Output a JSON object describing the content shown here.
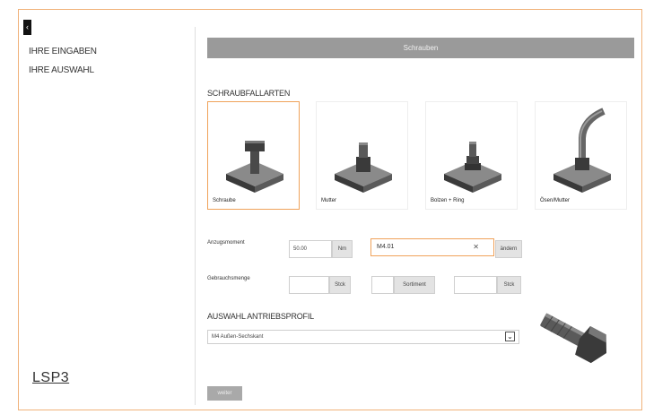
{
  "sidebar": {
    "items": [
      {
        "label": "IHRE EINGABEN"
      },
      {
        "label": "IHRE AUSWAHL"
      }
    ]
  },
  "logo": {
    "text": "LSP3"
  },
  "topbar": {
    "label": "Schrauben"
  },
  "schraubfall": {
    "heading": "SCHRAUBFALLARTEN",
    "cards": [
      {
        "label": "Schraube",
        "selected": true
      },
      {
        "label": "Mutter",
        "selected": false
      },
      {
        "label": "Bolzen + Ring",
        "selected": false
      },
      {
        "label": "Ösen/Mutter",
        "selected": false
      }
    ]
  },
  "row1": {
    "label": "Anzugsmoment",
    "value": "50.00",
    "unit": "Nm",
    "select_value": "M4.01",
    "select_clear": "✕",
    "side_btn": "ändern"
  },
  "row2": {
    "label": "Gebrauchsmenge",
    "fields": [
      {
        "value": "",
        "unit": "Stck"
      },
      {
        "value": "",
        "unit": "Sortiment"
      },
      {
        "value": "",
        "unit": "Stck"
      }
    ]
  },
  "antrieb": {
    "heading": "AUSWAHL ANTRIEBSPROFIL",
    "select_value": "M4 Außen-Sechskant"
  },
  "bottom_button": "weiter",
  "colors": {
    "accent": "#f0a25a",
    "bar": "#9a9a9a"
  }
}
